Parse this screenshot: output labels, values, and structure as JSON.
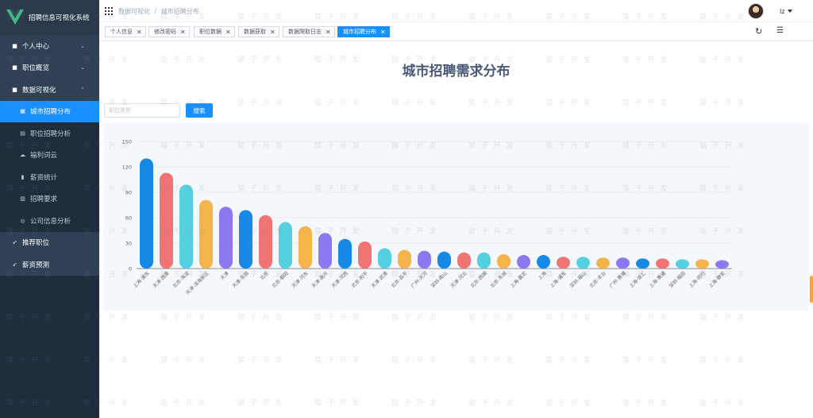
{
  "app": {
    "title": "招聘信息可视化系统"
  },
  "sidebar": {
    "items": [
      {
        "label": "个人中心",
        "icon": "square-icon",
        "chevron": "⌄"
      },
      {
        "label": "职位概览",
        "icon": "square-icon",
        "chevron": "⌄"
      },
      {
        "label": "数据可视化",
        "icon": "square-icon",
        "chevron": "⌃"
      }
    ],
    "sub_items": [
      {
        "label": "城市招聘分布",
        "icon": "chart-icon",
        "active": true
      },
      {
        "label": "职位招聘分析",
        "icon": "table-icon"
      },
      {
        "label": "福利词云",
        "icon": "cloud-icon"
      },
      {
        "label": "薪资统计",
        "icon": "bar-icon"
      },
      {
        "label": "招聘要求",
        "icon": "doc-icon"
      },
      {
        "label": "公司信息分析",
        "icon": "target-icon"
      }
    ],
    "bottom_items": [
      {
        "label": "推荐职位",
        "icon": "send-icon"
      },
      {
        "label": "薪资预测",
        "icon": "send-icon"
      }
    ]
  },
  "header": {
    "breadcrumb": [
      "数据可视化",
      "城市招聘分布"
    ],
    "breadcrumb_sep": "/",
    "user": "lz"
  },
  "tags": [
    {
      "label": "个人信息",
      "active": false
    },
    {
      "label": "修改密码",
      "active": false
    },
    {
      "label": "职位数据",
      "active": false
    },
    {
      "label": "数据获取",
      "active": false
    },
    {
      "label": "数据爬取日志",
      "active": false
    },
    {
      "label": "城市招聘分布",
      "active": true
    }
  ],
  "tag_close": "✕",
  "main": {
    "title": "城市招聘需求分布",
    "search_placeholder": "职位类型",
    "search_button": "搜索"
  },
  "watermark_text": "猿 子 开 发",
  "colors": {
    "accent": "#1890ff",
    "sidebar_bg": "#1f2d3d",
    "palette": [
      "#1689e6",
      "#f07474",
      "#55d0e0",
      "#f5b44a",
      "#8c78f0"
    ]
  },
  "chart_data": {
    "type": "bar",
    "title": "",
    "xlabel": "",
    "ylabel": "",
    "ylim": [
      0,
      150
    ],
    "yticks": [
      0,
      30,
      60,
      90,
      120,
      150
    ],
    "grid": true,
    "categories": [
      "上海-浦东",
      "天津-西青",
      "北京-海淀",
      "天津-滨海新区",
      "天津",
      "天津-东丽",
      "北京",
      "北京-朝阳",
      "天津-河东",
      "天津-南开",
      "天津-河西",
      "北京-和平",
      "天津-武清",
      "北京-昌平",
      "广州-天河",
      "深圳-南山",
      "天津-河北",
      "北京-西城",
      "北京-东城",
      "上海-嘉定",
      "上海",
      "上海-浦东",
      "深圳-福山",
      "北京-丰台",
      "广州-黄埔",
      "上海-徐汇",
      "上海-黄浦",
      "深圳-福田",
      "上海-闵行",
      "上海-静安"
    ],
    "values": [
      130,
      113,
      99,
      81,
      73,
      69,
      63,
      55,
      50,
      42,
      35,
      32,
      24,
      22,
      21,
      20,
      19,
      19,
      17,
      16,
      16,
      14,
      14,
      13,
      13,
      12,
      12,
      11,
      11,
      10
    ]
  }
}
